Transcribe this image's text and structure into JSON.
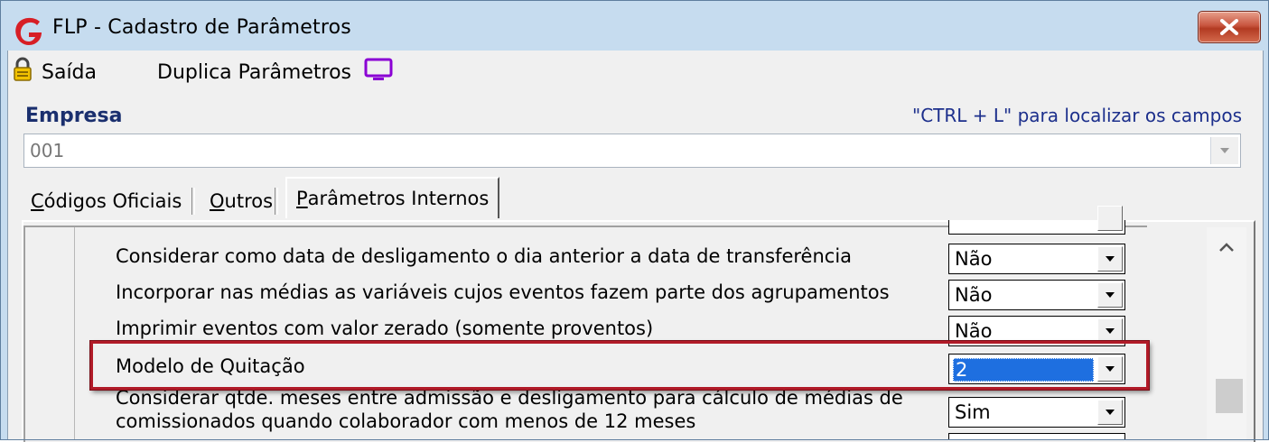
{
  "window": {
    "title": "FLP - Cadastro de Parâmetros",
    "accent_color": "#c6dcef",
    "close_icon": "close-icon"
  },
  "toolbar": {
    "exit_label": "Saída",
    "duplicate_label": "Duplica Parâmetros"
  },
  "empresa": {
    "label": "Empresa",
    "hint": "\"CTRL + L\" para localizar os campos",
    "value": "001"
  },
  "tabs": [
    {
      "label_first": "C",
      "label_rest": "ódigos Oficiais"
    },
    {
      "label_first": "O",
      "label_rest": "utros"
    },
    {
      "label_first": "P",
      "label_rest": "arâmetros Internos",
      "active": true
    }
  ],
  "rows": [
    {
      "label": "Considerar como data de desligamento o dia anterior a data de transferência",
      "value": "Não"
    },
    {
      "label": "Incorporar nas médias as variáveis cujos eventos fazem parte dos agrupamentos",
      "value": "Não"
    },
    {
      "label": "Imprimir eventos com valor zerado (somente proventos)",
      "value": "Não"
    },
    {
      "label": "Modelo de Quitação",
      "value": "2"
    },
    {
      "label_line1": "Considerar qtde. meses entre admissão e desligamento para cálculo de médias de",
      "label_line2": "comissionados quando colaborador com menos de 12 meses",
      "value": "Sim"
    }
  ],
  "highlight_color": "#b11b28"
}
